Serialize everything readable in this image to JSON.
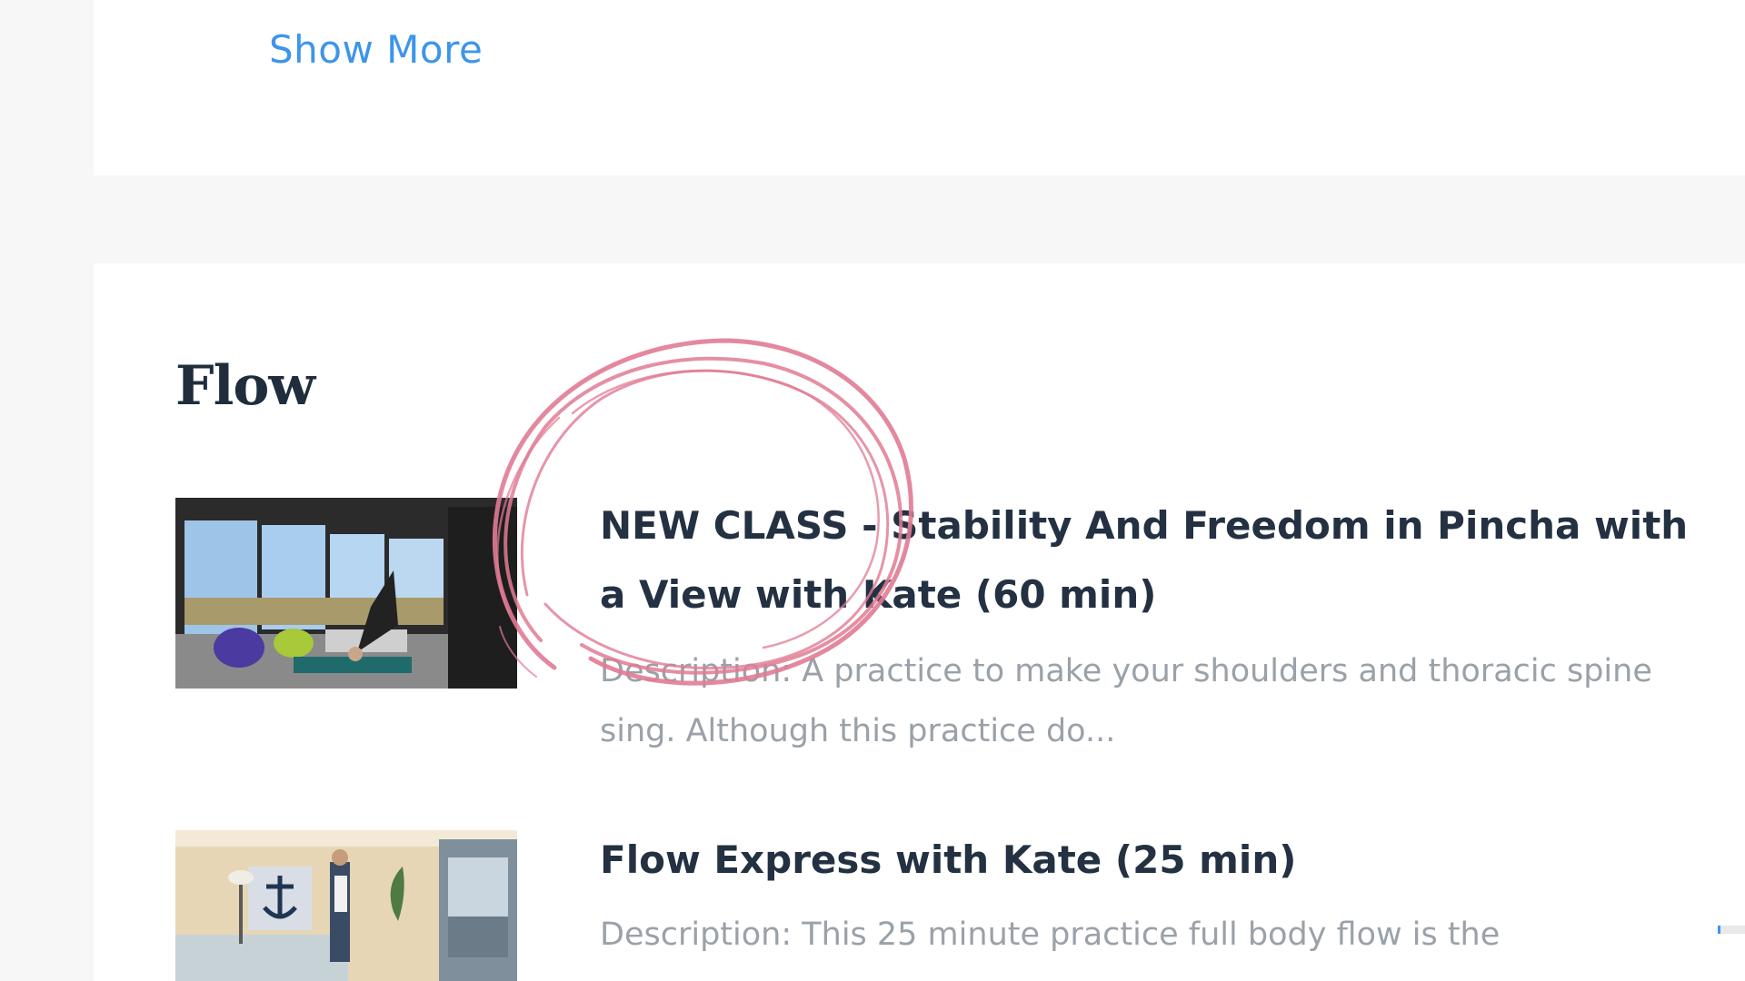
{
  "top": {
    "show_more": "Show More"
  },
  "flow": {
    "title": "Flow",
    "classes": [
      {
        "title": "NEW CLASS - Stability And Freedom in Pincha with a View with Kate (60 min)",
        "description": "Description: A practice to make your shoulders and thoracic spine sing. Although this practice do..."
      },
      {
        "title": "Flow Express with Kate (25 min)",
        "description": "Description: This 25 minute practice full body flow is the"
      }
    ]
  },
  "colors": {
    "accent": "#3d95ea",
    "heading": "#1f2d3d",
    "description": "#9aa1a9",
    "annotation": "#e07b93"
  }
}
